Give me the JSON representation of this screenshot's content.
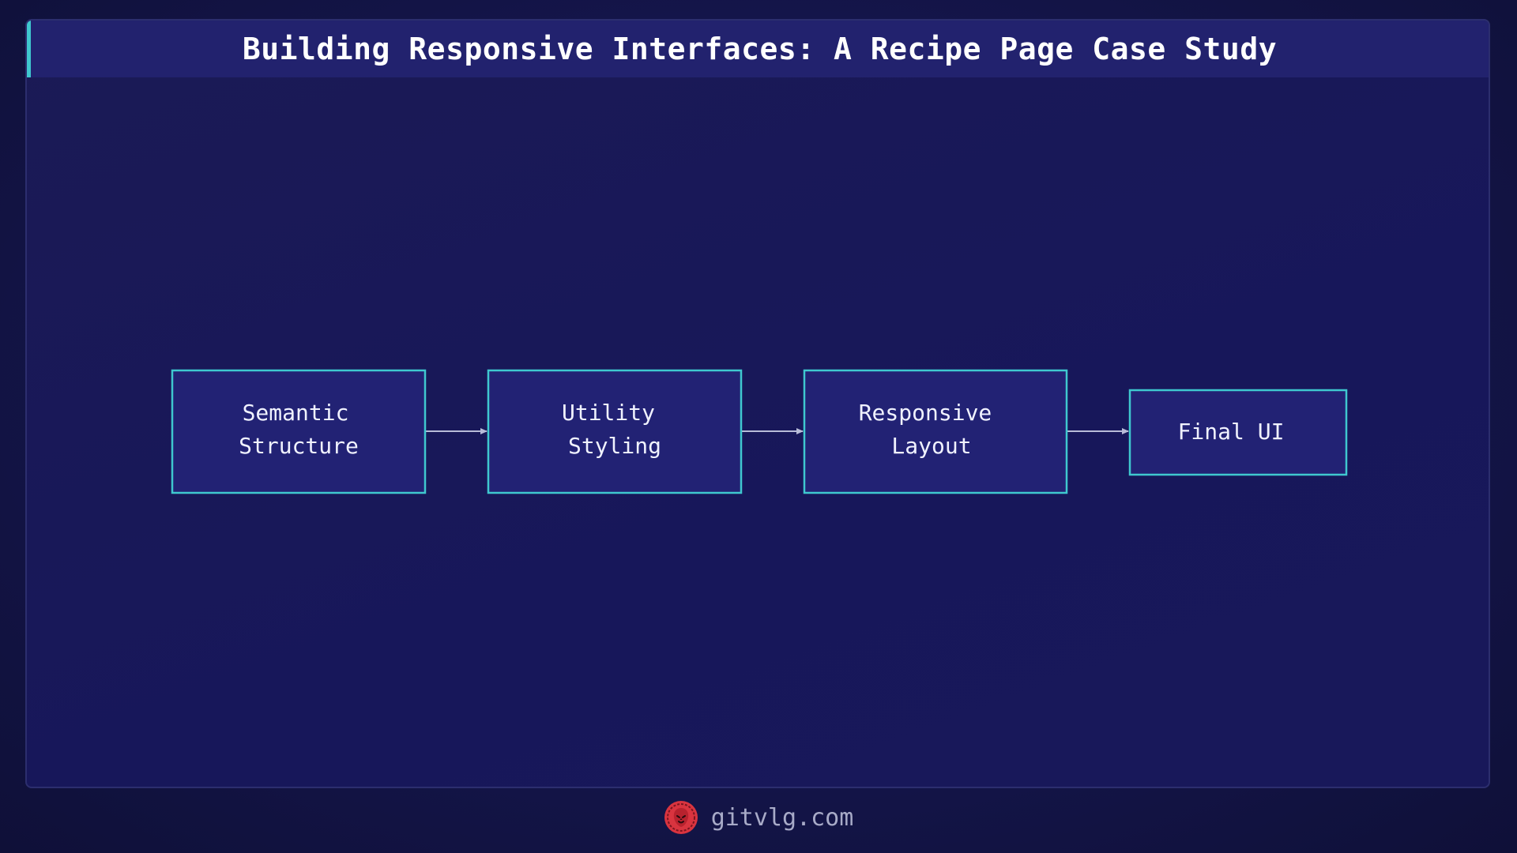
{
  "header": {
    "title": "Building Responsive Interfaces: A Recipe Page Case Study"
  },
  "diagram": {
    "type": "flowchart",
    "direction": "left-to-right",
    "nodes": [
      {
        "id": "semantic",
        "lines": [
          "Semantic",
          "Structure"
        ]
      },
      {
        "id": "utility",
        "lines": [
          "Utility",
          "Styling"
        ]
      },
      {
        "id": "responsive",
        "lines": [
          "Responsive",
          "Layout"
        ]
      },
      {
        "id": "final",
        "lines": [
          "Final UI"
        ]
      }
    ],
    "edges": [
      {
        "from": "semantic",
        "to": "utility"
      },
      {
        "from": "utility",
        "to": "responsive"
      },
      {
        "from": "responsive",
        "to": "final"
      }
    ],
    "colors": {
      "node_fill": "#222274",
      "node_border": "#3fc8cf",
      "edge": "#b8bcd8",
      "text": "#f0f2ff"
    }
  },
  "footer": {
    "logo_icon": "lion-head-icon",
    "site": "gitvlg.com",
    "logo_color": "#d9343f"
  }
}
